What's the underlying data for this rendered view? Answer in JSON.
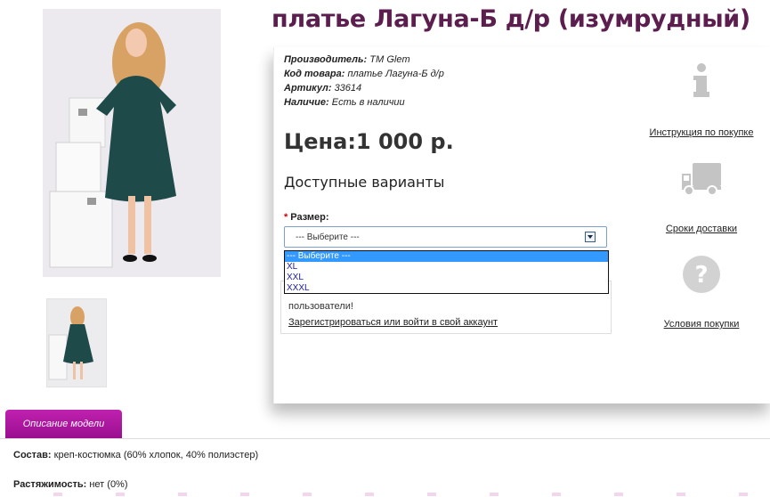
{
  "product": {
    "title": "платье Лагуна-Б д/р (изумрудный)",
    "meta": [
      {
        "label": "Производитель:",
        "value": "ТМ Glem"
      },
      {
        "label": "Код товара:",
        "value": "платье Лагуна-Б д/р"
      },
      {
        "label": "Артикул:",
        "value": "33614"
      },
      {
        "label": "Наличие:",
        "value": "Есть в наличии"
      }
    ],
    "price": "Цена:1 000 р.",
    "variants_title": "Доступные варианты",
    "size_label": "Размер:",
    "size_select_value": "--- Выберите ---",
    "size_options": [
      "--- Выберите ---",
      "XL",
      "XXL",
      "XXXL"
    ],
    "notice_text": "пользователи!",
    "notice_link": "Зарегистрироваться или войти в свой аккаунт"
  },
  "side": {
    "items": [
      {
        "icon": "info-icon",
        "label": "Инструкция по покупке"
      },
      {
        "icon": "truck-icon",
        "label": "Сроки доставки"
      },
      {
        "icon": "question-icon",
        "label": "Условия покупки"
      }
    ]
  },
  "tabs": {
    "description_label": "Описание модели"
  },
  "description": {
    "composition_label": "Состав:",
    "composition_value": "креп-костюмка (60% хлопок, 40% полиэстер)",
    "stretch_label": "Растяжимость:",
    "stretch_value": "нет (0%)"
  },
  "colors": {
    "title": "#5b1e4e",
    "tab": "#b01aa3",
    "dress": "#1f4a4a",
    "select_border": "#7ba0c9",
    "option_selected": "#3399ff"
  }
}
